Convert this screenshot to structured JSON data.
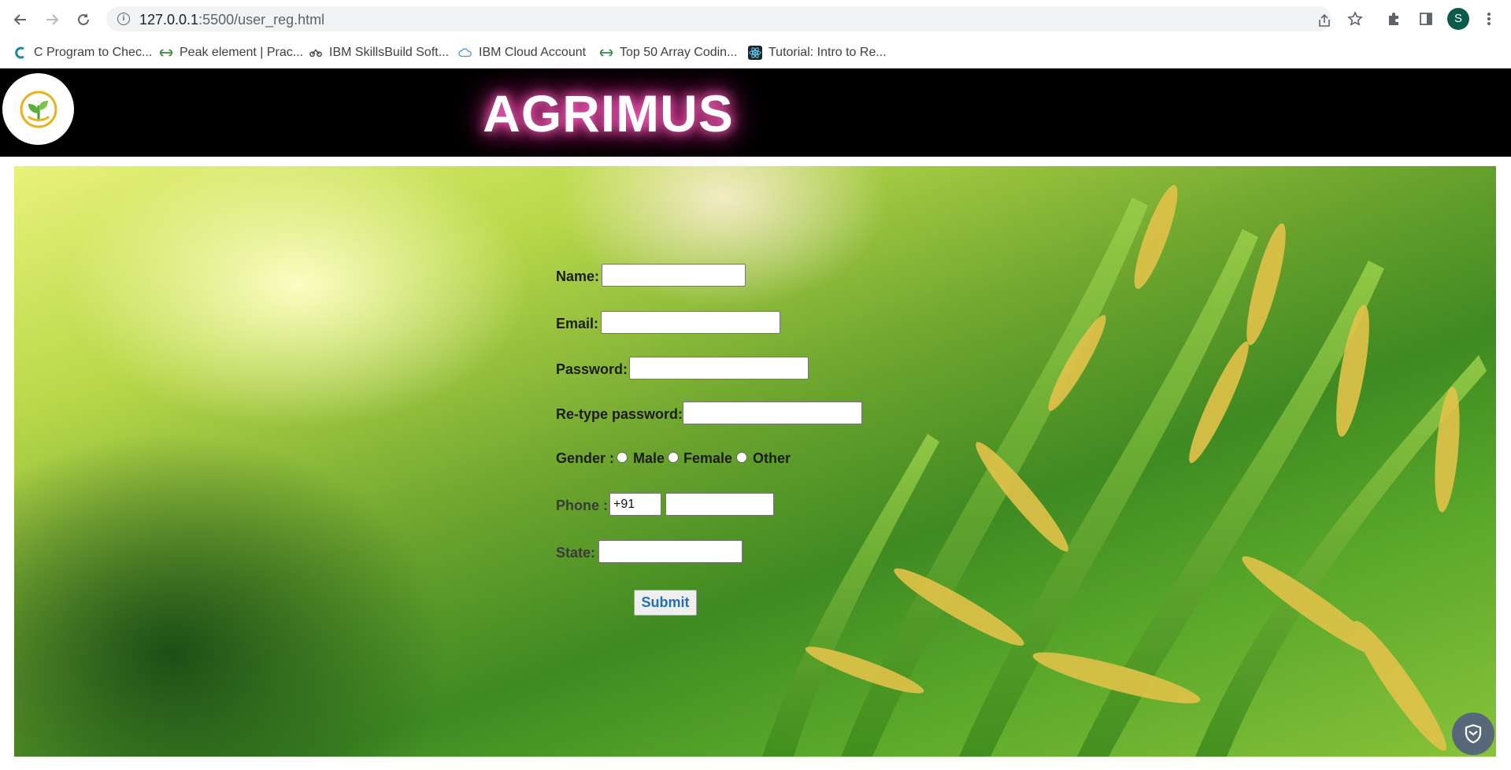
{
  "browser": {
    "url_host": "127.0.0.1",
    "url_path": ":5500/user_reg.html",
    "avatar_letter": "S",
    "bookmarks": [
      {
        "label": "C Program to Chec...",
        "icon": "c-logo-icon"
      },
      {
        "label": "Peak element | Prac...",
        "icon": "gfg-icon"
      },
      {
        "label": "IBM SkillsBuild Soft...",
        "icon": "ibm-skillsbuild-icon"
      },
      {
        "label": "IBM Cloud Account",
        "icon": "cloud-icon"
      },
      {
        "label": "Top 50 Array Codin...",
        "icon": "gfg-icon"
      },
      {
        "label": "Tutorial: Intro to Re...",
        "icon": "react-icon"
      }
    ]
  },
  "header": {
    "site_title": "AGRIMUS"
  },
  "form": {
    "name_label": "Name:",
    "email_label": "Email:",
    "password_label": "Password:",
    "retype_label": "Re-type password:",
    "gender_label": "Gender :",
    "gender_options": [
      "Male",
      "Female",
      "Other"
    ],
    "phone_label": "Phone :",
    "phone_code": "+91",
    "state_label": "State:",
    "submit_label": "Submit"
  },
  "colors": {
    "header_bg": "#000000",
    "title_glow": "#ff3fa8",
    "submit_text": "#1f6fb5"
  }
}
